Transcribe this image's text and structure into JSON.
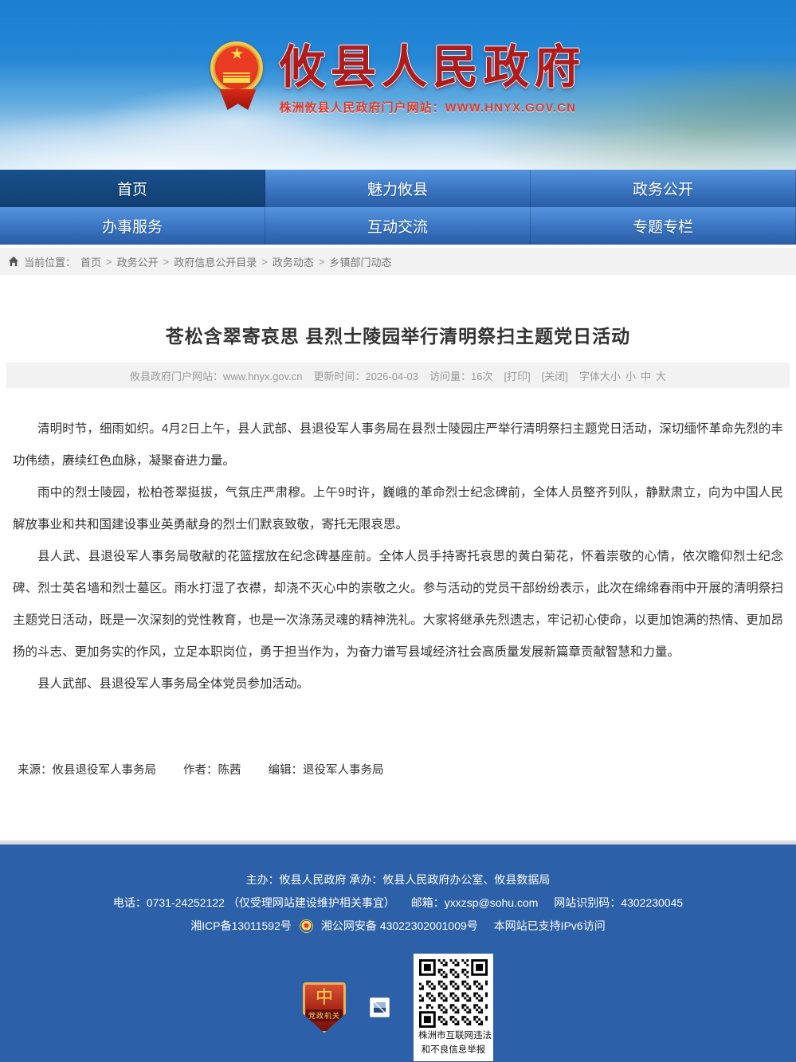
{
  "banner": {
    "site_title": "攸县人民政府",
    "site_subtitle": "株洲攸县人民政府门户网站：WWW.HNYX.GOV.CN"
  },
  "nav": {
    "items": [
      {
        "label": "首页",
        "active": true
      },
      {
        "label": "魅力攸县",
        "active": false
      },
      {
        "label": "政务公开",
        "active": false
      },
      {
        "label": "办事服务",
        "active": false
      },
      {
        "label": "互动交流",
        "active": false
      },
      {
        "label": "专题专栏",
        "active": false
      }
    ]
  },
  "breadcrumb": {
    "prefix": "当前位置：",
    "separator": ">",
    "items": [
      "首页",
      "政务公开",
      "政府信息公开目录",
      "政务动态",
      "乡镇部门动态"
    ]
  },
  "article": {
    "title": "苍松含翠寄哀思 县烈士陵园举行清明祭扫主题党日活动",
    "meta": {
      "site_label": "攸县政府门户网站：www.hnyx.gov.cn",
      "updated_label": "更新时间：2026-04-03",
      "visits_label": "访问量：16次",
      "print_label": "[打印]",
      "close_label": "[关闭]",
      "font_size_label": "字体大小",
      "font_small": "小",
      "font_medium": "中",
      "font_large": "大"
    },
    "paragraphs": {
      "0": "清明时节，细雨如织。4月2日上午，县人武部、县退役军人事务局在县烈士陵园庄严举行清明祭扫主题党日活动，深切缅怀革命先烈的丰功伟绩，赓续红色血脉，凝聚奋进力量。",
      "1": "雨中的烈士陵园，松柏苍翠挺拔，气氛庄严肃穆。上午9时许，巍峨的革命烈士纪念碑前，全体人员整齐列队，静默肃立，向为中国人民解放事业和共和国建设事业英勇献身的烈士们默哀致敬，寄托无限哀思。",
      "2": "县人武、县退役军人事务局敬献的花篮摆放在纪念碑基座前。全体人员手持寄托哀思的黄白菊花，怀着崇敬的心情，依次瞻仰烈士纪念碑、烈士英名墙和烈士墓区。雨水打湿了衣襟，却浇不灭心中的崇敬之火。参与活动的党员干部纷纷表示，此次在绵绵春雨中开展的清明祭扫主题党日活动，既是一次深刻的党性教育，也是一次涤荡灵魂的精神洗礼。大家将继承先烈遗志，牢记初心使命，以更加饱满的热情、更加昂扬的斗志、更加务实的作风，立足本职岗位，勇于担当作为，为奋力谱写县域经济社会高质量发展新篇章贡献智慧和力量。",
      "3": "县人武部、县退役军人事务局全体党员参加活动。"
    },
    "source_line": {
      "source": "来源：攸县退役军人事务局",
      "author": "作者：陈茜",
      "editor": "编辑：退役军人事务局"
    }
  },
  "footer": {
    "line1": "主办：攸县人民政府 承办：攸县人民政府办公室、攸县数据局",
    "line2_phone": "电话：0731-24252122 （仅受理网站建设维护相关事宜）",
    "line2_email": "邮箱：yxxzsp@sohu.com",
    "line2_site_id": "网站识别码：4302230045",
    "line3_icp": "湘ICP备13011592号",
    "line3_police": "湘公网安备 43022302001009号",
    "line3_ipv6": "本网站已支持IPv6访问",
    "gov_badge_label": "党政机关",
    "qr_caption_line1": "株洲市互联网违法",
    "qr_caption_line2": "和不良信息举报"
  },
  "colors": {
    "nav_active": "#123f72",
    "nav_normal": "#3a74c0",
    "footer_bg": "#2c60a8",
    "title_red": "#b01c1c",
    "subtitle_red": "#e23a2a"
  }
}
